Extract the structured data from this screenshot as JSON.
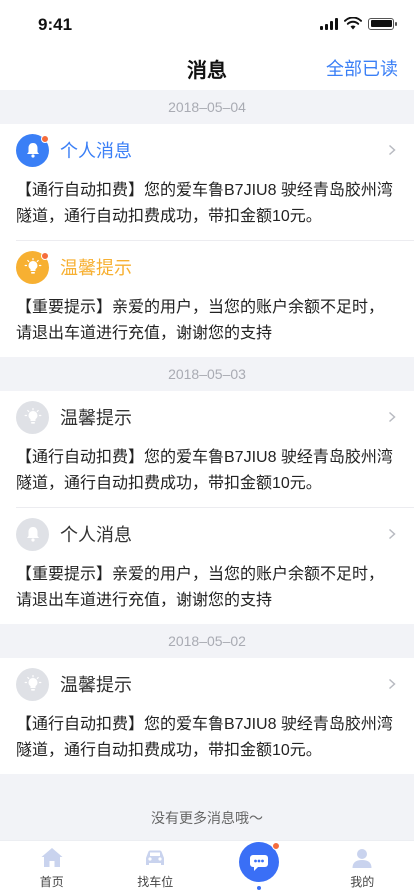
{
  "status": {
    "time": "9:41"
  },
  "nav": {
    "title": "消息",
    "action": "全部已读"
  },
  "groups": [
    {
      "date": "2018–05–04",
      "messages": [
        {
          "title": "个人消息",
          "icon": "bell-icon",
          "body": "【通行自动扣费】您的爱车鲁B7JIU8 驶经青岛胶州湾隧道，通行自动扣费成功，带扣金额10元。"
        },
        {
          "title": "温馨提示",
          "icon": "bulb-icon",
          "body": "【重要提示】亲爱的用户，当您的账户余额不足时，请退出车道进行充值，谢谢您的支持"
        }
      ]
    },
    {
      "date": "2018–05–03",
      "messages": [
        {
          "title": "温馨提示",
          "icon": "bulb-icon",
          "body": "【通行自动扣费】您的爱车鲁B7JIU8 驶经青岛胶州湾隧道，通行自动扣费成功，带扣金额10元。"
        },
        {
          "title": "个人消息",
          "icon": "bell-icon",
          "body": "【重要提示】亲爱的用户，当您的账户余额不足时，请退出车道进行充值，谢谢您的支持"
        }
      ]
    },
    {
      "date": "2018–05–02",
      "messages": [
        {
          "title": "温馨提示",
          "icon": "bulb-icon",
          "body": "【通行自动扣费】您的爱车鲁B7JIU8 驶经青岛胶州湾隧道，通行自动扣费成功，带扣金额10元。"
        }
      ]
    }
  ],
  "footer": {
    "no_more": "没有更多消息哦～"
  },
  "tabs": [
    {
      "label": "首页",
      "icon": "home-icon"
    },
    {
      "label": "找车位",
      "icon": "car-icon"
    },
    {
      "label": "",
      "icon": "message-icon"
    },
    {
      "label": "我的",
      "icon": "user-icon"
    }
  ],
  "colors": {
    "accent": "#3a7ff6",
    "orange": "#f7b032",
    "unread_dot": "#f56c3b",
    "read_icon_bg": "#dfe1e6"
  }
}
